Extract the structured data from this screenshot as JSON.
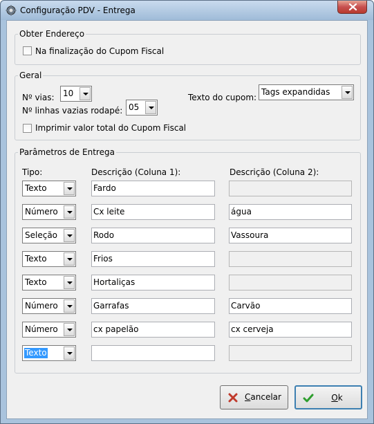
{
  "window": {
    "title": "Configuração PDV - Entrega"
  },
  "obter_endereco": {
    "legend": "Obter Endereço",
    "finalizacao_label": "Na finalização do Cupom Fiscal",
    "finalizacao_checked": false
  },
  "geral": {
    "legend": "Geral",
    "vias_label": "Nº vias:",
    "vias_value": "10",
    "linhas_label": "Nº linhas vazias rodapé:",
    "linhas_value": "05",
    "texto_cupom_label": "Texto do cupom:",
    "texto_cupom_value": "Tags expandidas",
    "imprimir_label": "Imprimir valor total do Cupom Fiscal",
    "imprimir_checked": false
  },
  "parametros": {
    "legend": "Parâmetros de Entrega",
    "headers": {
      "tipo": "Tipo:",
      "desc1": "Descrição (Coluna 1):",
      "desc2": "Descrição (Coluna 2):"
    },
    "rows": [
      {
        "tipo": "Texto",
        "desc1": "Fardo",
        "desc2": ""
      },
      {
        "tipo": "Número",
        "desc1": "Cx leite",
        "desc2": "água"
      },
      {
        "tipo": "Seleção",
        "desc1": "Rodo",
        "desc2": "Vassoura"
      },
      {
        "tipo": "Texto",
        "desc1": "Frios",
        "desc2": ""
      },
      {
        "tipo": "Texto",
        "desc1": "Hortaliças",
        "desc2": ""
      },
      {
        "tipo": "Número",
        "desc1": "Garrafas",
        "desc2": "Carvão"
      },
      {
        "tipo": "Número",
        "desc1": "cx papelão",
        "desc2": "cx cerveja"
      },
      {
        "tipo": "Texto",
        "desc1": "",
        "desc2": ""
      }
    ]
  },
  "buttons": {
    "cancel": "Cancelar",
    "ok": "Ok"
  },
  "colors": {
    "cancel_icon": "#c0392b",
    "ok_icon": "#2e9e2e",
    "selection": "#3399ff"
  }
}
